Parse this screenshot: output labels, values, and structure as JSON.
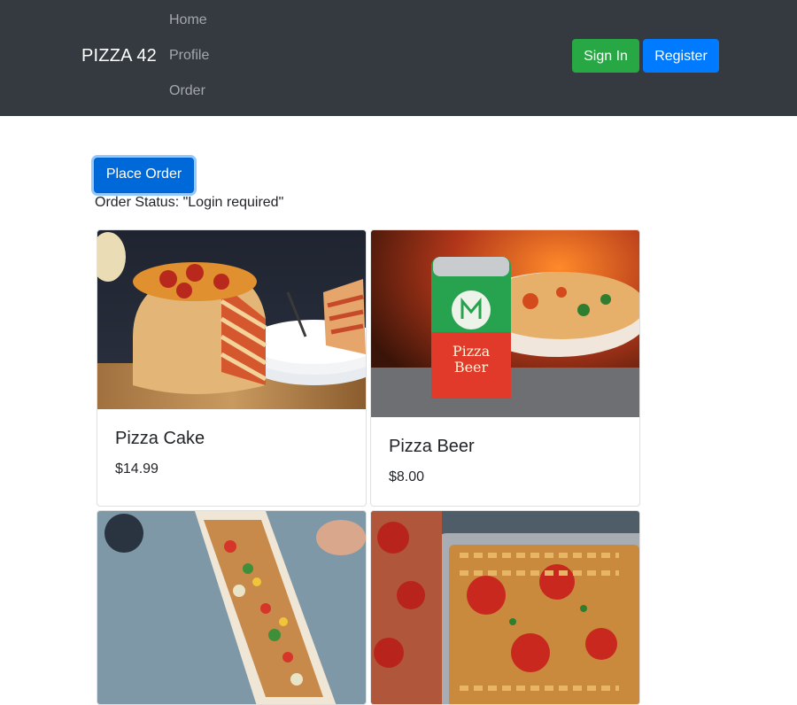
{
  "navbar": {
    "brand": "PIZZA 42",
    "links": [
      "Home",
      "Profile",
      "Order"
    ],
    "sign_in_label": "Sign In",
    "register_label": "Register"
  },
  "main": {
    "place_order_label": "Place Order",
    "order_status": "Order Status: \"Login required\""
  },
  "products": [
    {
      "name": "Pizza Cake",
      "price": "$14.99"
    },
    {
      "name": "Pizza Beer",
      "price": "$8.00"
    },
    {
      "name": "",
      "price": ""
    },
    {
      "name": "",
      "price": ""
    }
  ],
  "colors": {
    "navbar_bg": "#343a40",
    "success": "#28a745",
    "primary": "#007bff"
  }
}
